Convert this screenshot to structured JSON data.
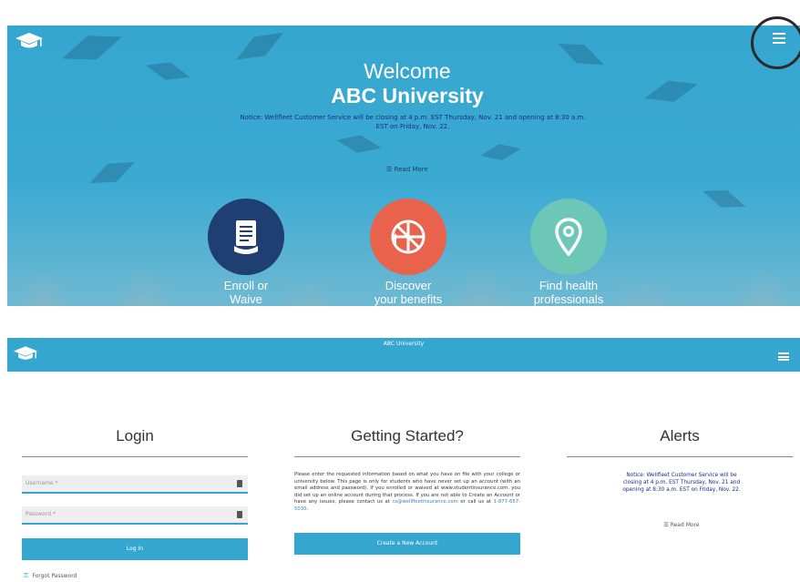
{
  "hero": {
    "welcome": "Welcome",
    "university": "ABC University",
    "notice": "Notice: Wellfleet Customer Service will be closing at 4 p.m. EST Thursday, Nov. 21 and opening at 8:30 a.m. EST on Friday, Nov. 22.",
    "read_more": "☰ Read More",
    "features": [
      {
        "label_line1": "Enroll or",
        "label_line2": "Waive",
        "icon": "document-icon",
        "color": "#1f3f73"
      },
      {
        "label_line1": "Discover",
        "label_line2": "your benefits",
        "icon": "pie-chart-icon",
        "color": "#e8624c"
      },
      {
        "label_line1": "Find health",
        "label_line2": "professionals",
        "icon": "map-pin-icon",
        "color": "#6cc7b6"
      }
    ],
    "arrow": "↓",
    "menu_icon": "hamburger-icon",
    "logo_icon": "graduation-cap-icon"
  },
  "topbar": {
    "title": "ABC University",
    "menu_icon": "hamburger-icon",
    "logo_icon": "graduation-cap-icon"
  },
  "login": {
    "title": "Login",
    "username_placeholder": "Username *",
    "password_placeholder": "Password *",
    "login_button": "Log In",
    "forgot_password": "Forgot Password",
    "forgot_icon": "key-icon"
  },
  "getting_started": {
    "title": "Getting Started?",
    "text_before_email": "Please enter the requested information based on what you have on file with your college or university below. This page is only for students who have never set up an account (with an email address and password). If you enrolled or waived at www.studentinsurance.com, you did set up an online account during that process. If you are not able to Create an Account or have any issues, please contact us at ",
    "email": "cs@wellfleetinsurance.com",
    "text_mid": " or call us at ",
    "phone": "1-877-657-5030",
    "text_end": ".",
    "create_button": "Create a New Account"
  },
  "alerts": {
    "title": "Alerts",
    "notice": "Notice: Wellfleet Customer Service will be closing at 4 p.m. EST Thursday, Nov. 21 and opening at 8:30 a.m. EST on Friday, Nov. 22.",
    "read_more": "☰ Read More"
  },
  "colors": {
    "brand_blue": "#35a6cf",
    "notice_text": "#1d2a8a",
    "enroll": "#1f3f73",
    "discover": "#e8624c",
    "find": "#6cc7b6"
  }
}
